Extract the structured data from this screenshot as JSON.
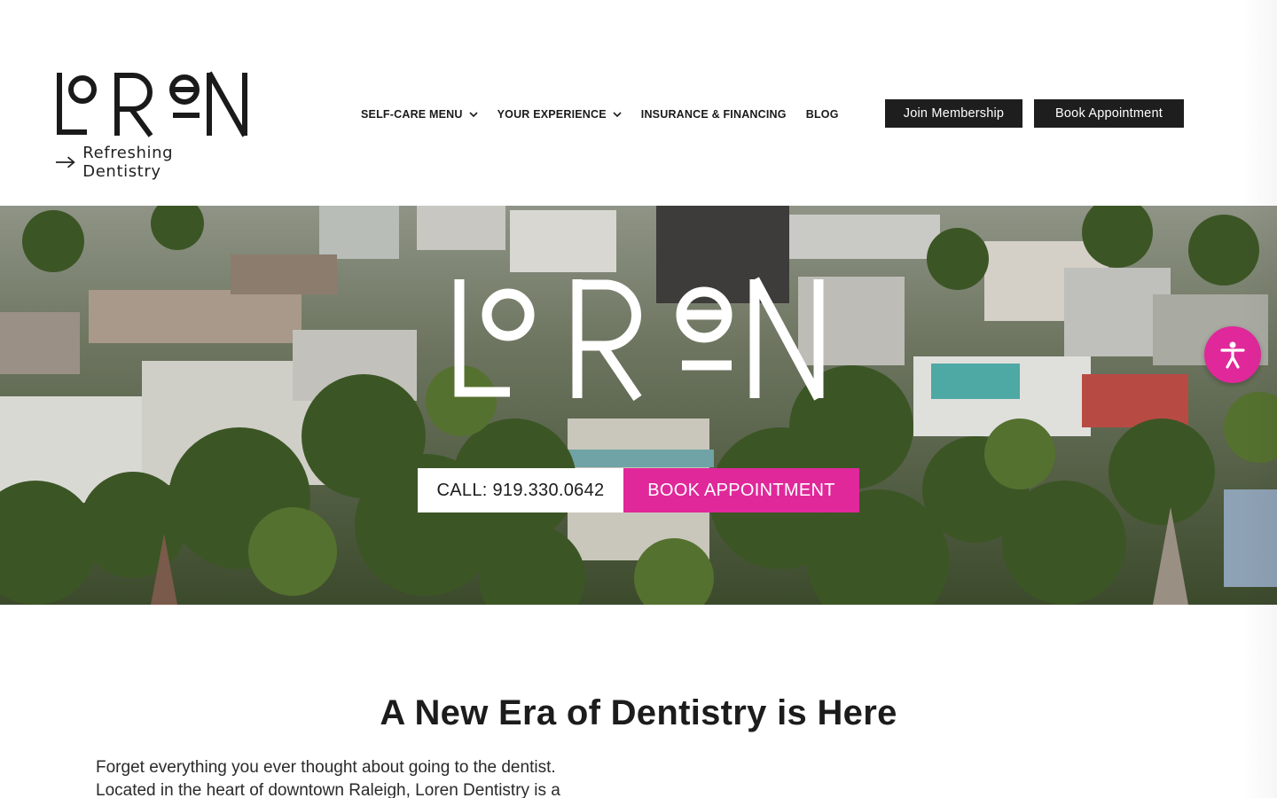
{
  "brand": {
    "name": "LOREN",
    "tagline": "Refreshing Dentistry"
  },
  "nav": {
    "items": [
      {
        "label": "SELF-CARE MENU",
        "has_dropdown": true
      },
      {
        "label": "YOUR EXPERIENCE",
        "has_dropdown": true
      },
      {
        "label": "INSURANCE & FINANCING",
        "has_dropdown": false
      },
      {
        "label": "BLOG",
        "has_dropdown": false
      }
    ]
  },
  "header_buttons": {
    "join": "Join Membership",
    "book": "Book Appointment"
  },
  "hero": {
    "logo_text": "LOREN",
    "call_label": "CALL: 919.330.0642",
    "book_label": "BOOK APPOINTMENT"
  },
  "accessibility": {
    "icon": "accessibility-icon"
  },
  "content": {
    "headline": "A New Era of Dentistry is Here",
    "paragraph_line1": "Forget everything you ever thought about going to the dentist.",
    "paragraph_line2": "Located in the heart of downtown Raleigh, Loren Dentistry is a"
  },
  "colors": {
    "accent": "#e0289a",
    "dark": "#1e1e1e",
    "text": "#1c1c1c"
  }
}
